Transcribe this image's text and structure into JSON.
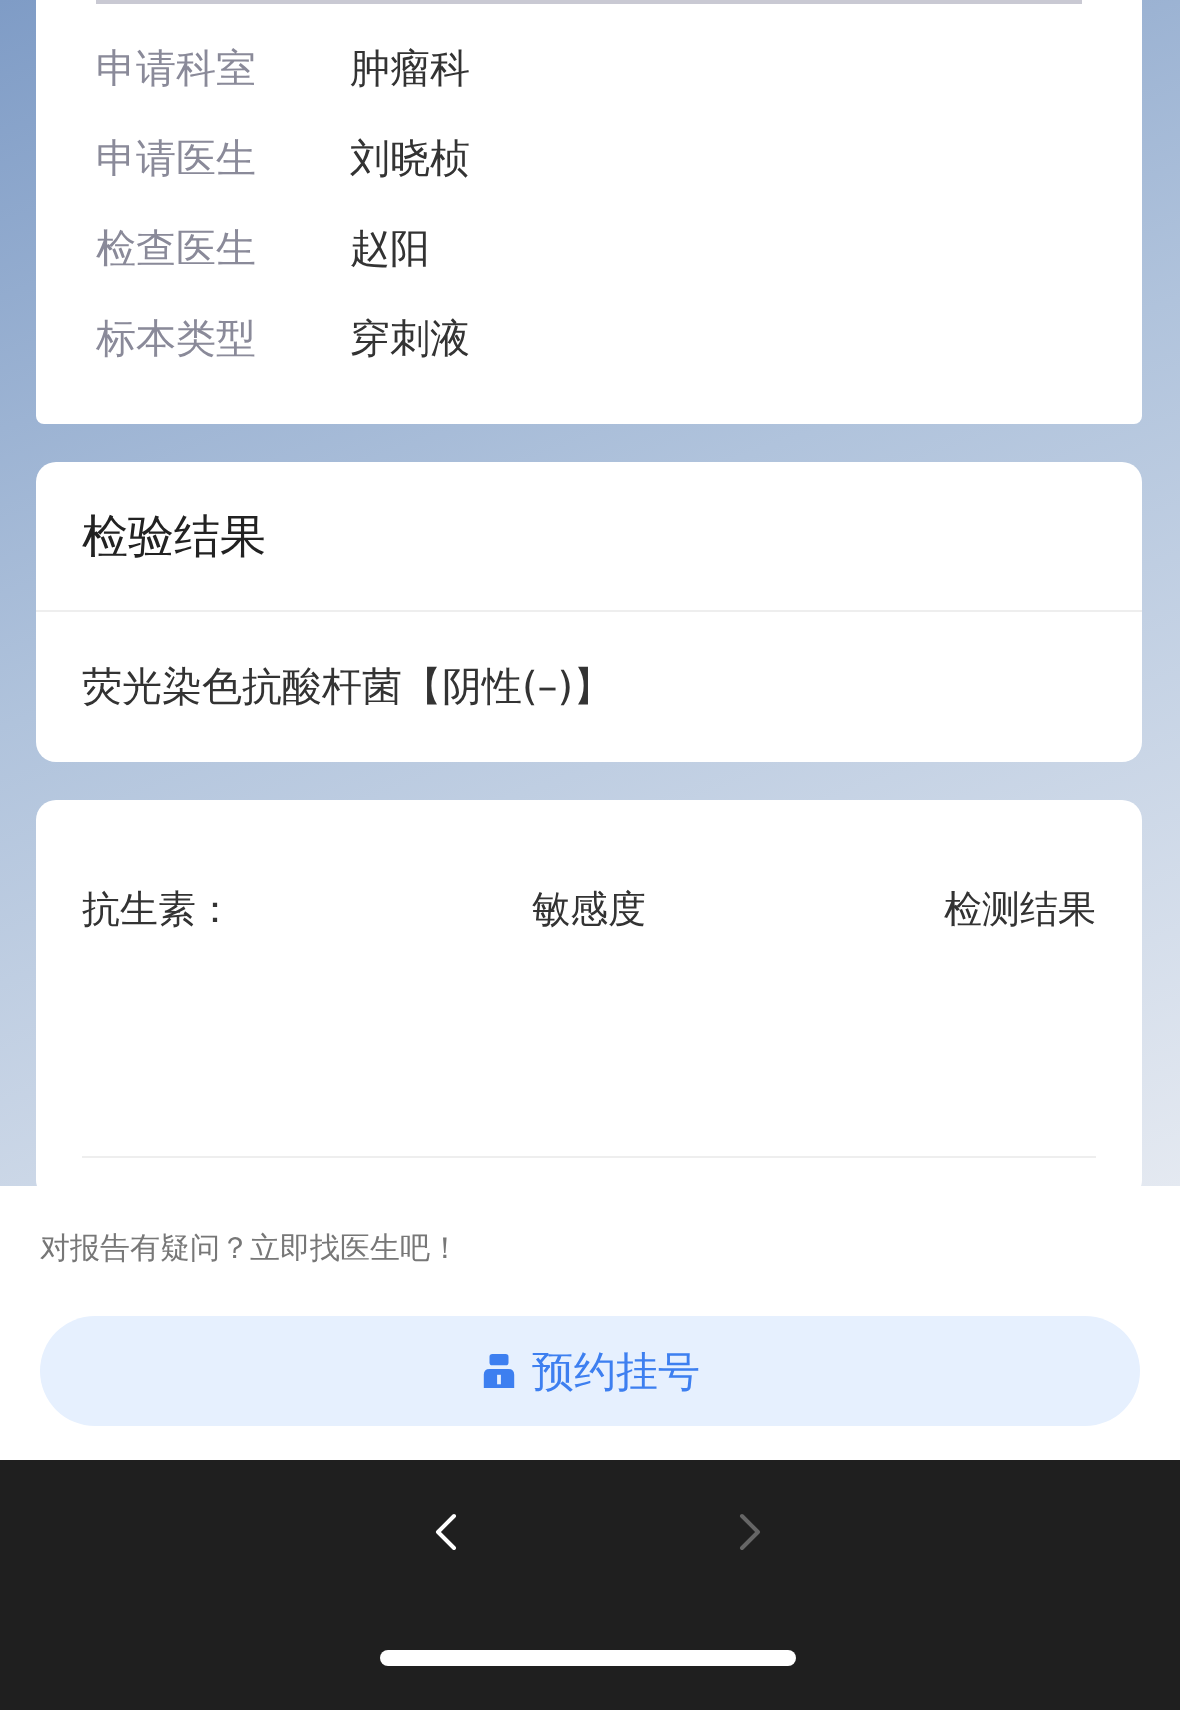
{
  "info_rows": [
    {
      "label": "申请科室",
      "value": "肿瘤科"
    },
    {
      "label": "申请医生",
      "value": "刘晓桢"
    },
    {
      "label": "检查医生",
      "value": "赵阳"
    },
    {
      "label": "标本类型",
      "value": "穿刺液"
    }
  ],
  "result_card": {
    "title": "检验结果",
    "items": [
      "荧光染色抗酸杆菌【阴性(–)】"
    ]
  },
  "sensitivity_table": {
    "columns": [
      "抗生素：",
      "敏感度",
      "检测结果"
    ]
  },
  "footer": {
    "prompt": "对报告有疑问？立即找医生吧！",
    "button": "预约挂号"
  },
  "nav": {
    "back": {
      "disabled": false
    },
    "forward": {
      "disabled": true
    }
  }
}
